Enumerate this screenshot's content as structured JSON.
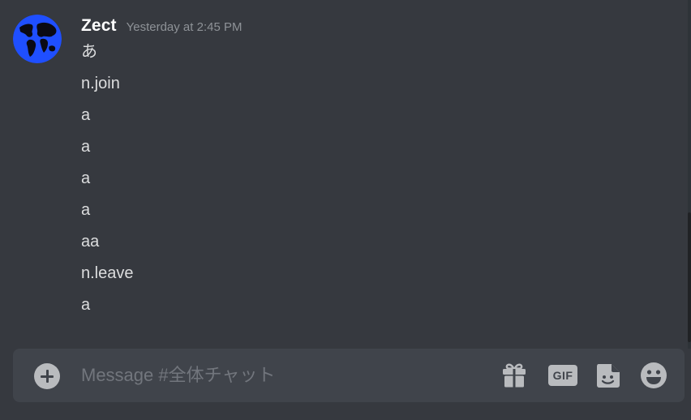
{
  "message": {
    "author": "Zect",
    "timestamp": "Yesterday at 2:45 PM",
    "lines": [
      "あ",
      "n.join",
      "a",
      "a",
      "a",
      "a",
      "aa",
      "n.leave",
      "a"
    ]
  },
  "composer": {
    "placeholder": "Message #全体チャット",
    "gif_label": "GIF",
    "icons": [
      "plus-circle-icon",
      "gift-icon",
      "gif-icon",
      "sticker-icon",
      "smile-icon"
    ]
  },
  "colors": {
    "background": "#36393f",
    "composer": "#40444b",
    "text": "#dcddde",
    "username": "#ffffff",
    "timestamp": "#8e9297",
    "icon": "#b9bbbe",
    "avatar_globe": "#1f4fff"
  }
}
